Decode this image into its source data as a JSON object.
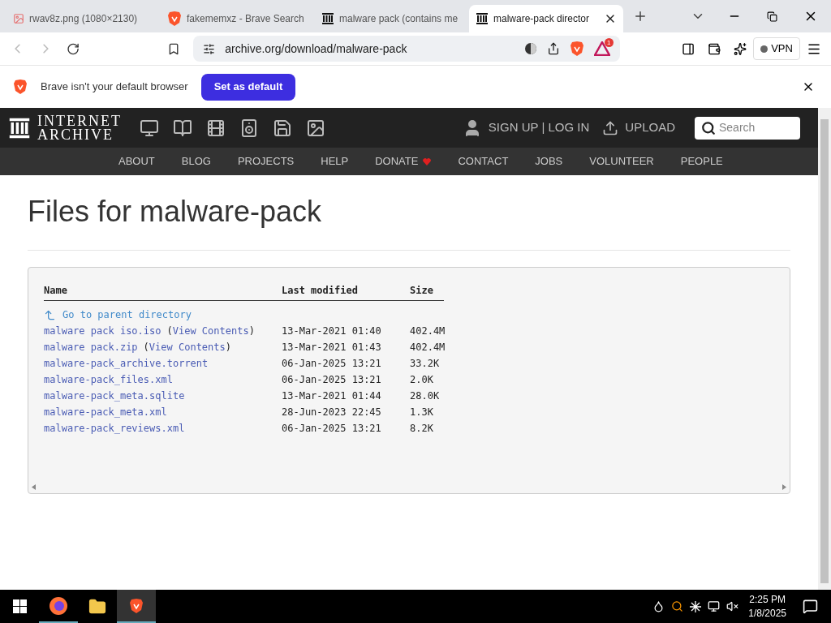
{
  "tabs": [
    {
      "title": "rwav8z.png (1080×2130)",
      "kind": "image",
      "selected": false
    },
    {
      "title": "fakememxz - Brave Search",
      "kind": "search",
      "selected": false
    },
    {
      "title": "malware pack (contains me",
      "kind": "site",
      "selected": false
    },
    {
      "title": "malware-pack director",
      "kind": "site",
      "selected": true
    }
  ],
  "address": "archive.org/download/malware-pack",
  "rewards_badge": "1",
  "vpn": "VPN",
  "infobar": {
    "message": "Brave isn't your default browser",
    "button": "Set as default"
  },
  "site": {
    "logo": [
      "INTERNET",
      "ARCHIVE"
    ],
    "sign_in": "SIGN UP | LOG IN",
    "upload": "UPLOAD",
    "search_placeholder": "Search",
    "nav": [
      "ABOUT",
      "BLOG",
      "PROJECTS",
      "HELP",
      "DONATE",
      "CONTACT",
      "JOBS",
      "VOLUNTEER",
      "PEOPLE"
    ]
  },
  "heading": "Files for malware-pack",
  "table": {
    "columns": [
      "Name",
      "Last modified",
      "Size"
    ],
    "parent": "Go to parent directory",
    "rows": [
      {
        "name": "malware pack iso.iso",
        "view": {
          "open": "(",
          "link": "View Contents",
          "close": ")"
        },
        "modified": "13-Mar-2021 01:40",
        "size": "402.4M"
      },
      {
        "name": "malware pack.zip",
        "view": {
          "open": "(",
          "link": "View Contents",
          "close": ")"
        },
        "modified": "13-Mar-2021 01:43",
        "size": "402.4M"
      },
      {
        "name": "malware-pack_archive.torrent",
        "modified": "06-Jan-2025 13:21",
        "size": "33.2K"
      },
      {
        "name": "malware-pack_files.xml",
        "modified": "06-Jan-2025 13:21",
        "size": "2.0K"
      },
      {
        "name": "malware-pack_meta.sqlite",
        "modified": "13-Mar-2021 01:44",
        "size": "28.0K"
      },
      {
        "name": "malware-pack_meta.xml",
        "modified": "28-Jun-2023 22:45",
        "size": "1.3K"
      },
      {
        "name": "malware-pack_reviews.xml",
        "modified": "06-Jan-2025 13:21",
        "size": "8.2K"
      }
    ]
  },
  "taskbar": {
    "time": "2:25 PM",
    "date": "1/8/2025"
  }
}
